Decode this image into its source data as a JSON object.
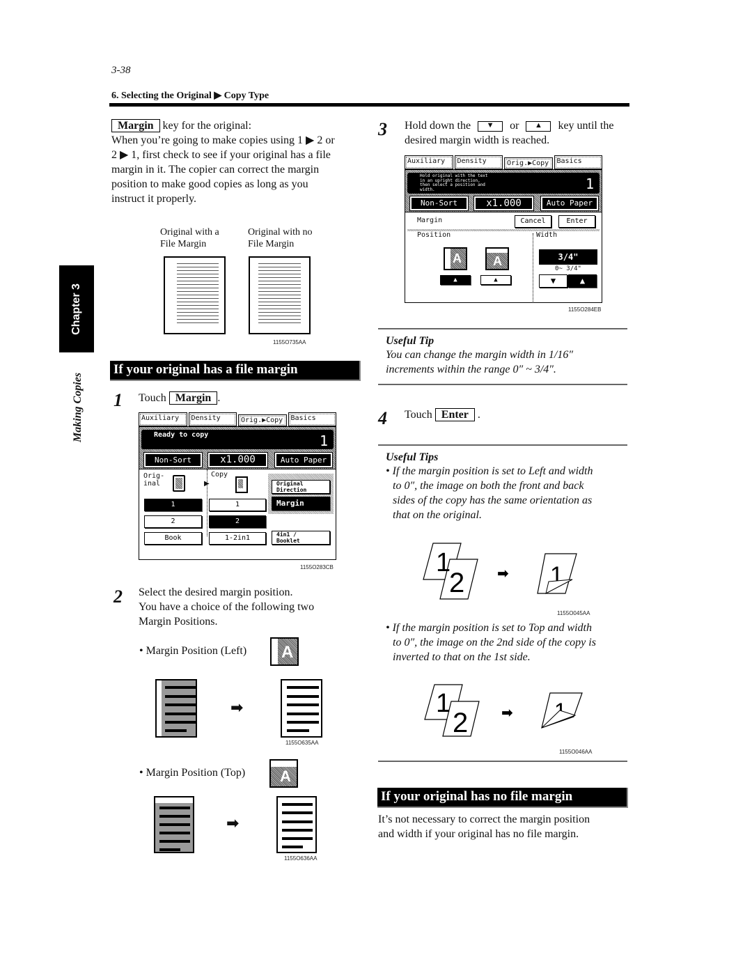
{
  "header": {
    "page_number": "3-38",
    "section": "6. Selecting the Original ▶ Copy Type"
  },
  "side_tab": {
    "chapter": "Chapter 3",
    "section_label": "Making Copies"
  },
  "intro": {
    "key_label": "Margin",
    "key_suffix": " key for the original:",
    "lines": [
      "When you’re going to make copies using 1 ▶ 2 or",
      "2 ▶ 1, first check to see if your original has a file",
      "margin in it. The copier can correct the margin",
      "position to make good copies as long as you",
      "instruct it properly."
    ]
  },
  "figure_originals": {
    "left_caption_1": "Original with a",
    "left_caption_2": "File Margin",
    "right_caption_1": "Original with no",
    "right_caption_2": "File Margin",
    "code": "1155O735AA"
  },
  "section_file_margin": {
    "heading": "If your original has a file margin",
    "step1": {
      "num": "1",
      "prefix": "Touch",
      "key": "Margin",
      "suffix": "."
    },
    "panel1": {
      "tabs": [
        "Auxiliary",
        "Density",
        "Orig.▶Copy",
        "Basics"
      ],
      "message": "Ready to copy",
      "count": "1",
      "buttons": [
        "Non-Sort",
        "x1.000",
        "Auto Paper"
      ],
      "original_label_1": "Orig-",
      "original_label_2": "inal",
      "copy_label": "Copy",
      "original_options": [
        "1",
        "2",
        "Book"
      ],
      "copy_options": [
        "1",
        "2",
        "1-2in1"
      ],
      "original_direction": "Original Direction",
      "margin": "Margin",
      "booklet_1": "4in1 /",
      "booklet_2": "Booklet",
      "code": "1155O283CB"
    },
    "step2": {
      "num": "2",
      "lines": [
        "Select the desired margin position.",
        "You have a choice of the following two",
        "Margin Positions."
      ],
      "position_left": "• Margin Position (Left)",
      "position_left_code": "1155O635AA",
      "position_top": "• Margin Position (Top)",
      "position_top_code": "1155O636AA",
      "icon_letter": "A"
    }
  },
  "step3": {
    "num": "3",
    "line1_a": "Hold down the",
    "line1_b": "or",
    "line1_c": "key until the",
    "line2": "desired margin width is reached.",
    "panel2": {
      "tabs": [
        "Auxiliary",
        "Density",
        "Orig.▶Copy",
        "Basics"
      ],
      "message_lines": [
        "Hold original with the text",
        "in an upright direction,",
        "then select a position and",
        "width."
      ],
      "count": "1",
      "buttons": [
        "Non-Sort",
        "x1.000",
        "Auto Paper"
      ],
      "margin_label": "Margin",
      "cancel": "Cancel",
      "enter": "Enter",
      "position_label": "Position",
      "width_label": "Width",
      "width_value": "3/4\"",
      "width_range": "0~ 3/4\"",
      "code": "1155O284EB"
    }
  },
  "tip1": {
    "title": "Useful Tip",
    "lines": [
      "You can change the margin width in 1/16″",
      "increments within the range 0″ ~ 3/4″."
    ]
  },
  "step4": {
    "num": "4",
    "prefix": "Touch",
    "key": "Enter",
    "suffix": "."
  },
  "tips2": {
    "title": "Useful Tips",
    "bullet1": [
      "• If the margin position is set to Left and width",
      "to 0″, the image on both the front and back",
      "sides of the copy has the same orientation as",
      "that on the original."
    ],
    "figure1_code": "1155O045AA",
    "bullet2": [
      "• If the margin position is set to Top and width",
      "to 0″, the image on the 2nd side of the copy is",
      "inverted to that on the 1st side."
    ],
    "figure2_code": "1155O046AA",
    "page1": "1",
    "page2": "2"
  },
  "section_no_margin": {
    "heading": "If your original has no file margin",
    "lines": [
      "It’s not necessary to correct the margin position",
      "and width if your original has no file margin."
    ]
  }
}
